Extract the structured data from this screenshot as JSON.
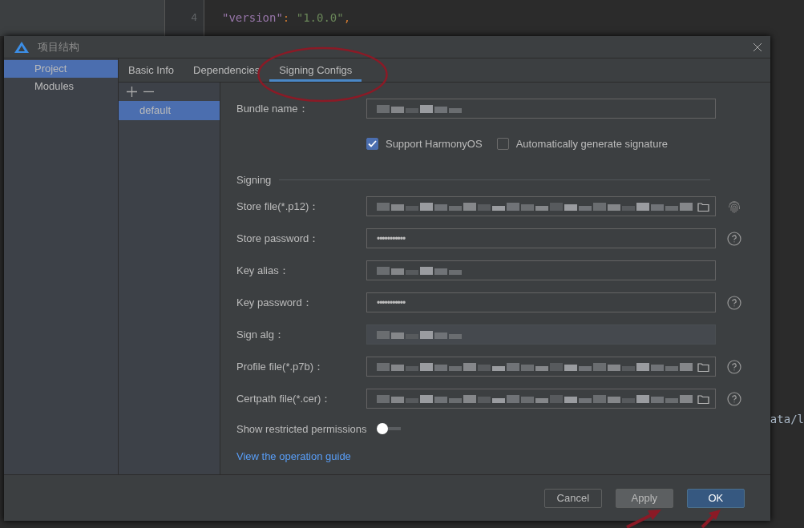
{
  "editor": {
    "lines": [
      {
        "number": "4",
        "tokens": [
          {
            "text": "\"version\"",
            "kind": "key"
          },
          {
            "text": ": ",
            "kind": "punct"
          },
          {
            "text": "\"1.0.0\"",
            "kind": "string"
          },
          {
            "text": ",",
            "kind": "punct"
          }
        ]
      }
    ],
    "fragment": "ata/l"
  },
  "dialog": {
    "title": "项目结构",
    "sidebar": [
      {
        "label": "Project",
        "selected": true
      },
      {
        "label": "Modules",
        "selected": false
      }
    ],
    "tabs": [
      {
        "label": "Basic Info",
        "selected": false
      },
      {
        "label": "Dependencies",
        "selected": false
      },
      {
        "label": "Signing Configs",
        "selected": true
      }
    ],
    "configs": [
      {
        "label": "default",
        "selected": true
      }
    ],
    "bundle": {
      "label": "Bundle name：",
      "blurred": true
    },
    "options": [
      {
        "label": "Support HarmonyOS",
        "checked": true
      },
      {
        "label": "Automatically generate signature",
        "checked": false
      }
    ],
    "section": "Signing",
    "fields": [
      {
        "label": "Store file(*.p12)：",
        "kind": "file",
        "blurred": true,
        "disabled": false,
        "fingerprint": true,
        "help": false
      },
      {
        "label": "Store password：",
        "kind": "password",
        "value": "•••••••••••",
        "disabled": false,
        "fingerprint": false,
        "help": true
      },
      {
        "label": "Key alias：",
        "kind": "text",
        "blurred": true,
        "disabled": false,
        "fingerprint": false,
        "help": false
      },
      {
        "label": "Key password：",
        "kind": "password",
        "value": "•••••••••••",
        "disabled": false,
        "fingerprint": false,
        "help": true
      },
      {
        "label": "Sign alg：",
        "kind": "text",
        "blurred": true,
        "disabled": true,
        "fingerprint": false,
        "help": false
      },
      {
        "label": "Profile file(*.p7b)：",
        "kind": "file",
        "blurred": true,
        "disabled": false,
        "fingerprint": false,
        "help": true
      },
      {
        "label": "Certpath file(*.cer)：",
        "kind": "file",
        "blurred": true,
        "disabled": false,
        "fingerprint": false,
        "help": true
      }
    ],
    "toggle": {
      "label": "Show restricted permissions",
      "on": false
    },
    "link": "View the operation guide",
    "buttons": [
      {
        "label": "Cancel",
        "kind": "secondary"
      },
      {
        "label": "Apply",
        "kind": "hovered"
      },
      {
        "label": "OK",
        "kind": "primary"
      }
    ]
  }
}
